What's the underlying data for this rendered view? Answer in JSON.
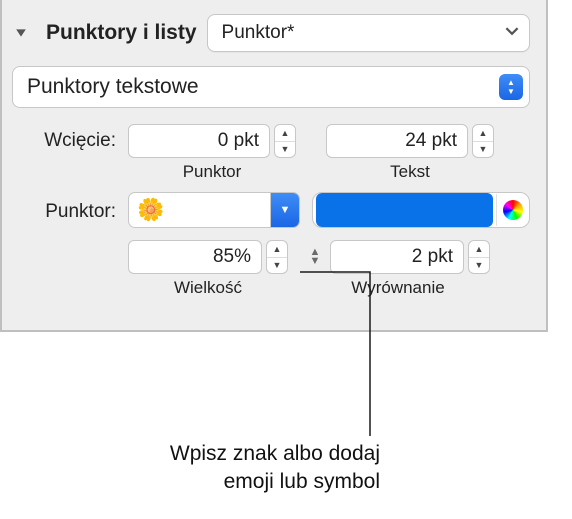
{
  "header": {
    "section_label": "Punktory i listy",
    "preset_label": "Punktor*"
  },
  "bullet_type": {
    "selected": "Punktory tekstowe"
  },
  "indent": {
    "label": "Wcięcie:",
    "bullet_value": "0 pkt",
    "bullet_caption": "Punktor",
    "text_value": "24 pkt",
    "text_caption": "Tekst"
  },
  "bullet": {
    "label": "Punktor:",
    "glyph": "🌼",
    "color": "#0a72e8"
  },
  "size_align": {
    "size_value": "85%",
    "size_caption": "Wielkość",
    "align_value": "2 pkt",
    "align_caption": "Wyrównanie"
  },
  "callout": {
    "line1": "Wpisz znak albo dodaj",
    "line2": "emoji lub symbol"
  }
}
